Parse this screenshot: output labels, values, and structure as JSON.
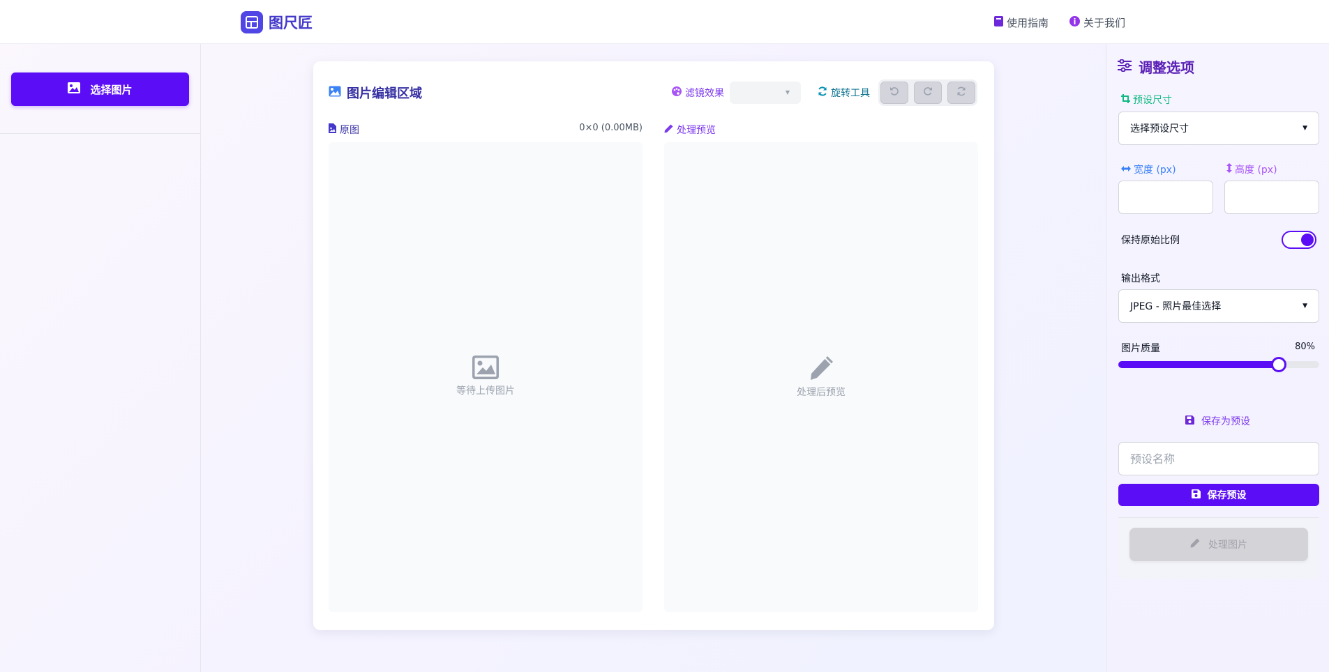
{
  "app": {
    "name": "图尺匠"
  },
  "nav": {
    "guide": "使用指南",
    "about": "关于我们"
  },
  "sidebar_left": {
    "select_image": "选择图片"
  },
  "editor": {
    "title": "图片编辑区域",
    "filter_label": "滤镜效果",
    "filter_value": "",
    "rotate_label": "旋转工具",
    "original_label": "原图",
    "original_info": "0×0 (0.00MB)",
    "preview_label": "处理预览",
    "original_placeholder": "等待上传图片",
    "preview_placeholder": "处理后预览"
  },
  "options": {
    "title": "调整选项",
    "preset_size_label": "预设尺寸",
    "preset_size_value": "选择预设尺寸",
    "width_label": "宽度 (px)",
    "height_label": "高度 (px)",
    "width_value": "",
    "height_value": "",
    "keep_ratio_label": "保持原始比例",
    "keep_ratio_on": true,
    "output_format_label": "输出格式",
    "output_format_value": "JPEG - 照片最佳选择",
    "quality_label": "图片质量",
    "quality_display": "80%",
    "quality_value": 0.8,
    "save_as_preset": "保存为预设",
    "preset_name_placeholder": "预设名称",
    "save_preset_button": "保存预设",
    "process_button": "处理图片"
  },
  "colors": {
    "primary": "#5b0ef5",
    "title": "#3730a3",
    "accent_purple": "#7c3aed",
    "accent_teal": "#0e7490",
    "accent_green": "#10b981",
    "accent_blue": "#3b82f6",
    "accent_pink": "#a855f7"
  }
}
